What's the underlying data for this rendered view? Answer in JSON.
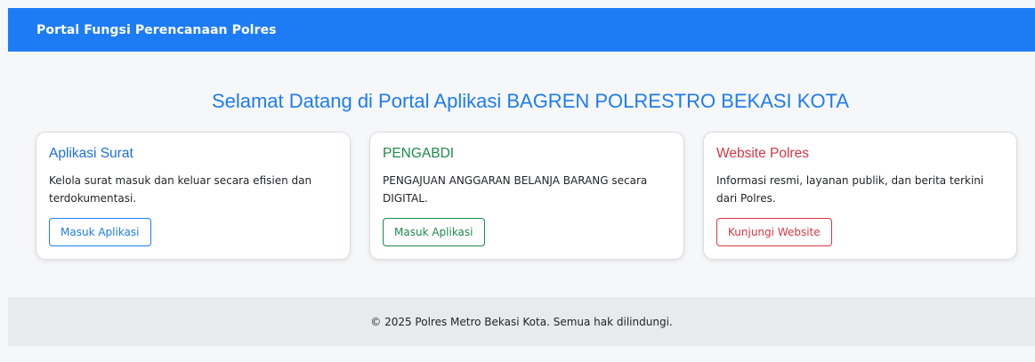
{
  "navbar": {
    "brand": "Portal Fungsi Perencanaan Polres"
  },
  "hero": {
    "title": "Selamat Datang di Portal Aplikasi BAGREN POLRESTRO BEKASI KOTA"
  },
  "cards": [
    {
      "title": "Aplikasi Surat",
      "text": "Kelola surat masuk dan keluar secara efisien dan terdokumentasi.",
      "button": "Masuk Aplikasi",
      "accent": "#1d7cf5"
    },
    {
      "title": "PENGABDI",
      "text": "PENGAJUAN ANGGARAN BELANJA BARANG secara DIGITAL.",
      "button": "Masuk Aplikasi",
      "accent": "#1d8a4a"
    },
    {
      "title": "Website Polres",
      "text": "Informasi resmi, layanan publik, dan berita terkini dari Polres.",
      "button": "Kunjungi Website",
      "accent": "#dc3545"
    }
  ],
  "footer": {
    "text": "© 2025 Polres Metro Bekasi Kota. Semua hak dilindungi."
  },
  "colors": {
    "primary": "#1d7cf5",
    "background": "#f6f7f9",
    "footer_bg": "#e8eaec"
  }
}
